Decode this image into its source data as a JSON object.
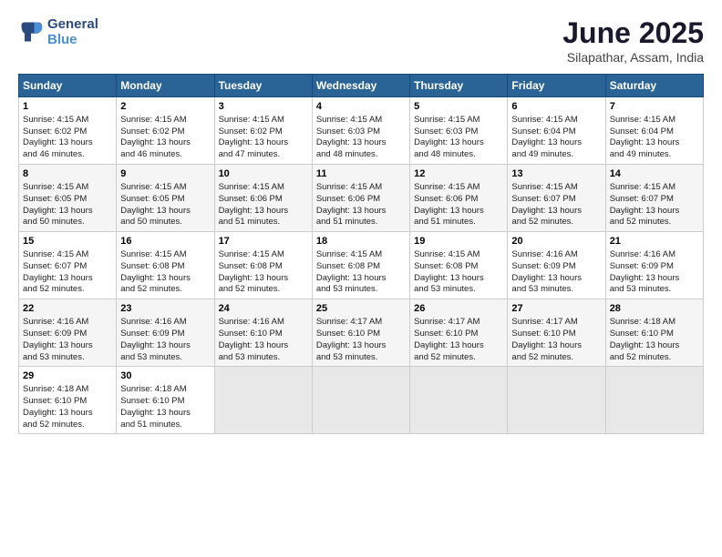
{
  "logo": {
    "line1": "General",
    "line2": "Blue"
  },
  "title": "June 2025",
  "location": "Silapathar, Assam, India",
  "days_of_week": [
    "Sunday",
    "Monday",
    "Tuesday",
    "Wednesday",
    "Thursday",
    "Friday",
    "Saturday"
  ],
  "weeks": [
    [
      {
        "day": "1",
        "info": "Sunrise: 4:15 AM\nSunset: 6:02 PM\nDaylight: 13 hours\nand 46 minutes."
      },
      {
        "day": "2",
        "info": "Sunrise: 4:15 AM\nSunset: 6:02 PM\nDaylight: 13 hours\nand 46 minutes."
      },
      {
        "day": "3",
        "info": "Sunrise: 4:15 AM\nSunset: 6:02 PM\nDaylight: 13 hours\nand 47 minutes."
      },
      {
        "day": "4",
        "info": "Sunrise: 4:15 AM\nSunset: 6:03 PM\nDaylight: 13 hours\nand 48 minutes."
      },
      {
        "day": "5",
        "info": "Sunrise: 4:15 AM\nSunset: 6:03 PM\nDaylight: 13 hours\nand 48 minutes."
      },
      {
        "day": "6",
        "info": "Sunrise: 4:15 AM\nSunset: 6:04 PM\nDaylight: 13 hours\nand 49 minutes."
      },
      {
        "day": "7",
        "info": "Sunrise: 4:15 AM\nSunset: 6:04 PM\nDaylight: 13 hours\nand 49 minutes."
      }
    ],
    [
      {
        "day": "8",
        "info": "Sunrise: 4:15 AM\nSunset: 6:05 PM\nDaylight: 13 hours\nand 50 minutes."
      },
      {
        "day": "9",
        "info": "Sunrise: 4:15 AM\nSunset: 6:05 PM\nDaylight: 13 hours\nand 50 minutes."
      },
      {
        "day": "10",
        "info": "Sunrise: 4:15 AM\nSunset: 6:06 PM\nDaylight: 13 hours\nand 51 minutes."
      },
      {
        "day": "11",
        "info": "Sunrise: 4:15 AM\nSunset: 6:06 PM\nDaylight: 13 hours\nand 51 minutes."
      },
      {
        "day": "12",
        "info": "Sunrise: 4:15 AM\nSunset: 6:06 PM\nDaylight: 13 hours\nand 51 minutes."
      },
      {
        "day": "13",
        "info": "Sunrise: 4:15 AM\nSunset: 6:07 PM\nDaylight: 13 hours\nand 52 minutes."
      },
      {
        "day": "14",
        "info": "Sunrise: 4:15 AM\nSunset: 6:07 PM\nDaylight: 13 hours\nand 52 minutes."
      }
    ],
    [
      {
        "day": "15",
        "info": "Sunrise: 4:15 AM\nSunset: 6:07 PM\nDaylight: 13 hours\nand 52 minutes."
      },
      {
        "day": "16",
        "info": "Sunrise: 4:15 AM\nSunset: 6:08 PM\nDaylight: 13 hours\nand 52 minutes."
      },
      {
        "day": "17",
        "info": "Sunrise: 4:15 AM\nSunset: 6:08 PM\nDaylight: 13 hours\nand 52 minutes."
      },
      {
        "day": "18",
        "info": "Sunrise: 4:15 AM\nSunset: 6:08 PM\nDaylight: 13 hours\nand 53 minutes."
      },
      {
        "day": "19",
        "info": "Sunrise: 4:15 AM\nSunset: 6:08 PM\nDaylight: 13 hours\nand 53 minutes."
      },
      {
        "day": "20",
        "info": "Sunrise: 4:16 AM\nSunset: 6:09 PM\nDaylight: 13 hours\nand 53 minutes."
      },
      {
        "day": "21",
        "info": "Sunrise: 4:16 AM\nSunset: 6:09 PM\nDaylight: 13 hours\nand 53 minutes."
      }
    ],
    [
      {
        "day": "22",
        "info": "Sunrise: 4:16 AM\nSunset: 6:09 PM\nDaylight: 13 hours\nand 53 minutes."
      },
      {
        "day": "23",
        "info": "Sunrise: 4:16 AM\nSunset: 6:09 PM\nDaylight: 13 hours\nand 53 minutes."
      },
      {
        "day": "24",
        "info": "Sunrise: 4:16 AM\nSunset: 6:10 PM\nDaylight: 13 hours\nand 53 minutes."
      },
      {
        "day": "25",
        "info": "Sunrise: 4:17 AM\nSunset: 6:10 PM\nDaylight: 13 hours\nand 53 minutes."
      },
      {
        "day": "26",
        "info": "Sunrise: 4:17 AM\nSunset: 6:10 PM\nDaylight: 13 hours\nand 52 minutes."
      },
      {
        "day": "27",
        "info": "Sunrise: 4:17 AM\nSunset: 6:10 PM\nDaylight: 13 hours\nand 52 minutes."
      },
      {
        "day": "28",
        "info": "Sunrise: 4:18 AM\nSunset: 6:10 PM\nDaylight: 13 hours\nand 52 minutes."
      }
    ],
    [
      {
        "day": "29",
        "info": "Sunrise: 4:18 AM\nSunset: 6:10 PM\nDaylight: 13 hours\nand 52 minutes."
      },
      {
        "day": "30",
        "info": "Sunrise: 4:18 AM\nSunset: 6:10 PM\nDaylight: 13 hours\nand 51 minutes."
      },
      {
        "day": "",
        "info": ""
      },
      {
        "day": "",
        "info": ""
      },
      {
        "day": "",
        "info": ""
      },
      {
        "day": "",
        "info": ""
      },
      {
        "day": "",
        "info": ""
      }
    ]
  ]
}
